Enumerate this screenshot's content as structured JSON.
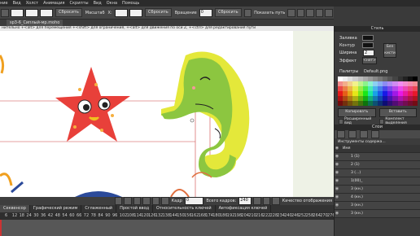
{
  "menubar": {
    "items": [
      "ние",
      "Вид",
      "Холст",
      "Анимация",
      "Скрипты",
      "Вид",
      "Окна",
      "Помощь"
    ]
  },
  "toolbar": {
    "reset1": "Сбросить",
    "scale": "Масштаб",
    "x_label": "X:",
    "reset2": "Сбросить",
    "rotation": "Вращение",
    "rotation_value": "0",
    "reset3": "Сбросить",
    "motion_path": "Показать путь"
  },
  "doc_tab": "sp3-6_Сиплый-мр.moho",
  "hint": "нительно +<alt> для перемещения +<shift> для ограничения, +<alt> для движения по оси Z, +<ctrl> для редактирования пути",
  "right": {
    "style_header": "Стиль",
    "fill_label": "Заливка",
    "stroke_label": "Контур",
    "width_label": "Ширина",
    "width_value": "2",
    "effect_label": "Эффект",
    "effect_value": "<нет>",
    "no_brush": "Без кисти",
    "palette_label": "Палитры",
    "palette_value": "Default.png",
    "copy_btn": "Копировать",
    "paste_btn": "Вставить",
    "advanced": "Расширенный вид",
    "highlight": "Комплект выделения",
    "layers_header": "Слои",
    "layers_tool": "Инструменты содержа...",
    "layers": [
      "Имя",
      "1 (1)",
      "2 (1)",
      "3 (...)",
      "1(00)_",
      "3 (кн.)",
      "4 (кн.)",
      "3 (кн.)",
      "3 (кн.)"
    ]
  },
  "playbar": {
    "frame_label": "Кадр",
    "frame_value": "0",
    "total_label": "Всего кадров:",
    "total_value": "240",
    "quality": "Качество отображения"
  },
  "timeline_tabs": [
    "Секвенсор",
    "Графический режим",
    "Сглаженный",
    "Простой ввод",
    "Относительность ключей",
    "Автофиксация ключей"
  ],
  "ruler_ticks": [
    "6",
    "12",
    "18",
    "24",
    "30",
    "36",
    "42",
    "48",
    "54",
    "60",
    "66",
    "72",
    "78",
    "84",
    "90",
    "96",
    "102",
    "108",
    "114",
    "120",
    "126",
    "132",
    "138",
    "144",
    "150",
    "156",
    "162",
    "168",
    "174",
    "180",
    "186",
    "192",
    "198",
    "204",
    "210",
    "216",
    "222",
    "228",
    "234",
    "240",
    "246",
    "252",
    "258",
    "264",
    "270",
    "276"
  ],
  "colors": {
    "accent": "#6a8fd8",
    "starfish": "#e8403a",
    "seahorse": "#8cc640",
    "seahorse_fin": "#e4e83a"
  }
}
